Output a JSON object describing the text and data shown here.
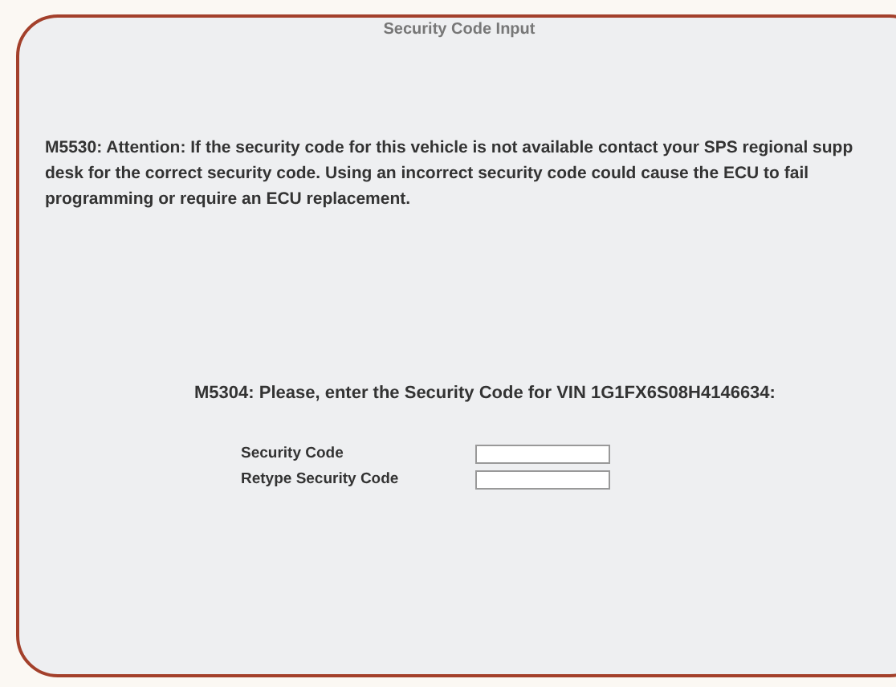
{
  "window": {
    "title": "Security Code Input"
  },
  "attention": {
    "lines": [
      "M5530: Attention: If the security code for this vehicle is not available contact your SPS regional supp",
      "desk for the correct security code. Using an incorrect security code could cause the ECU to fail",
      "programming or require an ECU replacement."
    ]
  },
  "prompt": "M5304: Please, enter the Security Code for VIN 1G1FX6S08H4146634:",
  "fields": [
    {
      "label": "Security Code"
    },
    {
      "label": "Retype Security Code"
    }
  ]
}
